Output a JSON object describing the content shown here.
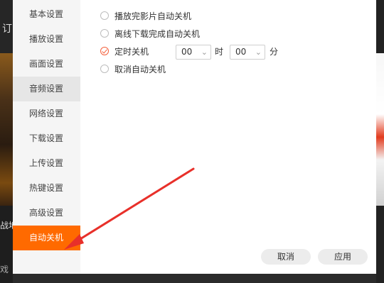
{
  "background": {
    "top_glyph": "订",
    "text_1": "战地",
    "text_2": "戏"
  },
  "sidebar": {
    "items": [
      {
        "label": "基本设置"
      },
      {
        "label": "播放设置"
      },
      {
        "label": "画面设置"
      },
      {
        "label": "音频设置"
      },
      {
        "label": "网络设置"
      },
      {
        "label": "下载设置"
      },
      {
        "label": "上传设置"
      },
      {
        "label": "热键设置"
      },
      {
        "label": "高级设置"
      },
      {
        "label": "自动关机"
      }
    ],
    "hover_index": 3,
    "active_index": 9
  },
  "options": {
    "after_video": "播放完影片自动关机",
    "after_download": "离线下载完成自动关机",
    "timed": "定时关机",
    "cancel": "取消自动关机",
    "selected": "timed"
  },
  "timer": {
    "hour": "00",
    "hour_unit": "时",
    "minute": "00",
    "minute_unit": "分"
  },
  "footer": {
    "cancel_label": "取消",
    "apply_label": "应用"
  },
  "colors": {
    "accent": "#ff6a00",
    "check": "#f4603c",
    "annotation": "#e8302a"
  }
}
